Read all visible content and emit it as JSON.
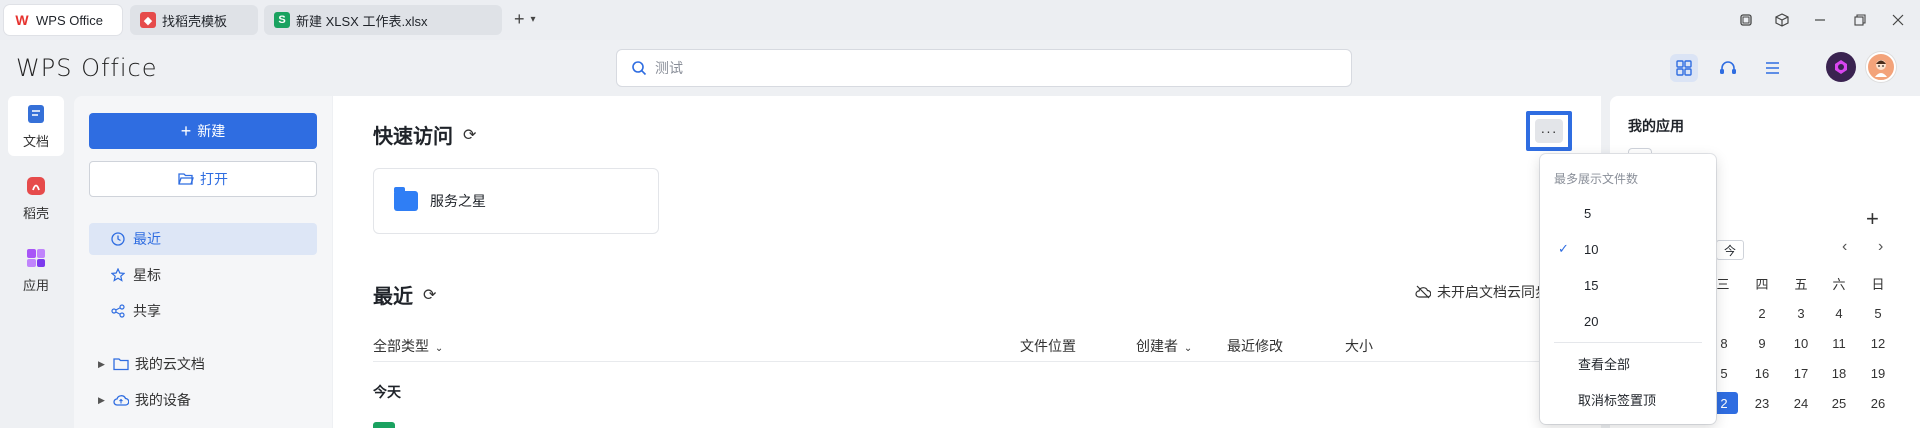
{
  "tabs": [
    {
      "label": "WPS Office",
      "icon": "wps-logo-icon",
      "color": "#e6322e"
    },
    {
      "label": "找稻壳模板",
      "icon": "docer-icon",
      "color": "#e64b4b"
    },
    {
      "label": "新建 XLSX 工作表.xlsx",
      "icon": "spreadsheet-icon",
      "icon_text": "S",
      "color": "#1aa260"
    }
  ],
  "new_tab_icon": "+",
  "header": {
    "logo": "WPS Office",
    "search_placeholder": "测试"
  },
  "rail": [
    {
      "label": "文档",
      "icon": "document-icon"
    },
    {
      "label": "稻壳",
      "icon": "docer-icon"
    },
    {
      "label": "应用",
      "icon": "apps-icon"
    }
  ],
  "sidebar": {
    "new_label": "新建",
    "open_label": "打开",
    "nav": [
      {
        "label": "最近",
        "icon": "clock-icon"
      },
      {
        "label": "星标",
        "icon": "star-icon"
      },
      {
        "label": "共享",
        "icon": "share-icon"
      }
    ],
    "tree": [
      {
        "label": "我的云文档",
        "icon": "folder-icon"
      },
      {
        "label": "我的设备",
        "icon": "cloud-device-icon"
      }
    ]
  },
  "main": {
    "quick_title": "快速访问",
    "quick_item": "服务之星",
    "recent_title": "最近",
    "cloud_note": "未开启文档云同步",
    "columns": {
      "type": "全部类型",
      "location": "文件位置",
      "creator": "创建者",
      "modified": "最近修改",
      "size": "大小"
    },
    "group_today": "今天"
  },
  "menu": {
    "header": "最多展示文件数",
    "options": [
      "5",
      "10",
      "15",
      "20"
    ],
    "selected": "10",
    "view_all": "查看全部",
    "unpin": "取消标签置顶"
  },
  "right_panel": {
    "title": "我的应用",
    "today_label": "今",
    "weekday_headers": [
      "三",
      "四",
      "五",
      "六",
      "日"
    ],
    "calendar_rows": [
      [
        "",
        "2",
        "3",
        "4",
        "5"
      ],
      [
        "8",
        "9",
        "10",
        "11",
        "12"
      ],
      [
        "5",
        "16",
        "17",
        "18",
        "19"
      ],
      [
        "2",
        "23",
        "24",
        "25",
        "26"
      ]
    ],
    "selected_day": "22"
  },
  "colors": {
    "accent": "#2f6de1",
    "wps_red": "#e6322e",
    "sheet_green": "#1aa260"
  }
}
